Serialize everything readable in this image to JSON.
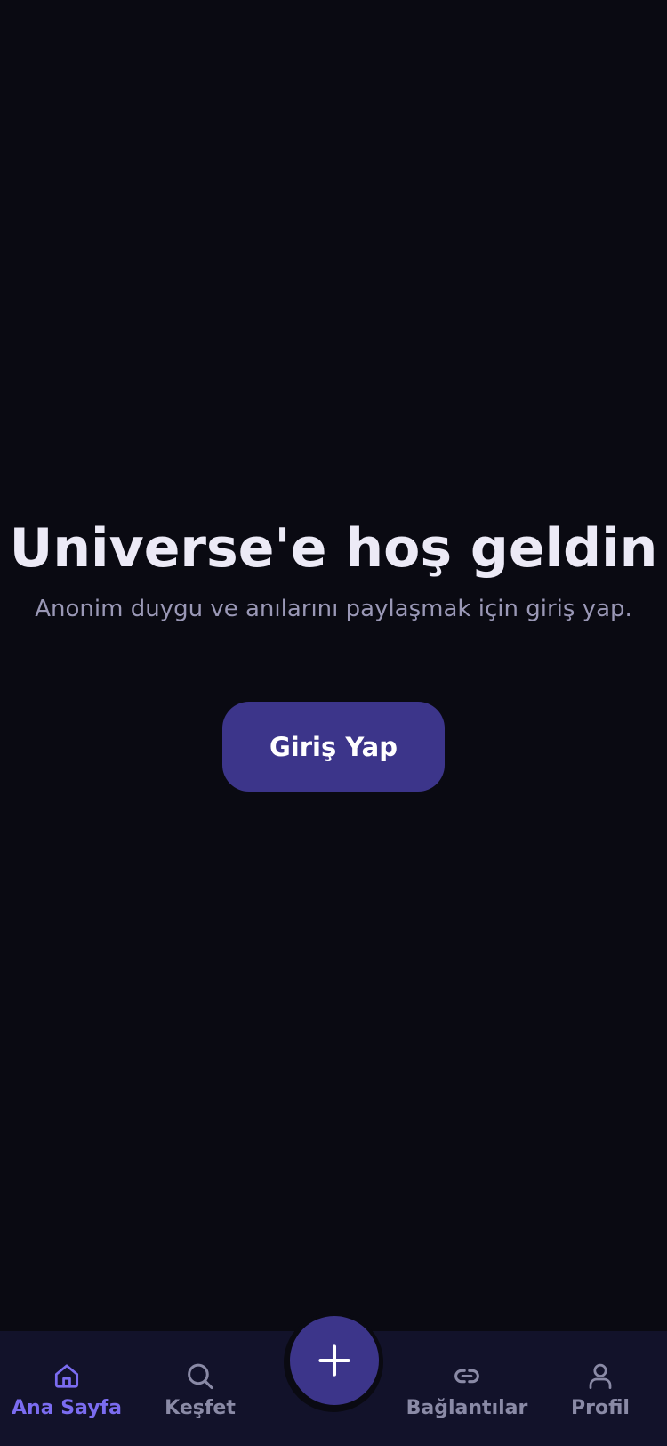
{
  "welcome": {
    "title": "Universe'e hoş geldin",
    "subtitle": "Anonim duygu ve anılarını paylaşmak için giriş yap."
  },
  "login_button": {
    "label": "Giriş Yap"
  },
  "tab_bar": {
    "active_color": "#7b6cf0",
    "inactive_color": "#8a8aa6",
    "items": [
      {
        "label": "Ana Sayfa",
        "icon": "home-icon",
        "active": true
      },
      {
        "label": "Keşfet",
        "icon": "search-icon",
        "active": false
      },
      {
        "label": "Bağlantılar",
        "icon": "link-icon",
        "active": false
      },
      {
        "label": "Profil",
        "icon": "user-icon",
        "active": false
      }
    ]
  },
  "fab": {
    "icon": "plus-icon"
  },
  "colors": {
    "background": "#0a0a12",
    "tab_bar_background": "#12122a",
    "primary": "#3c358a",
    "title_text": "#eceaf6",
    "subtitle_text": "#9a98b6"
  }
}
